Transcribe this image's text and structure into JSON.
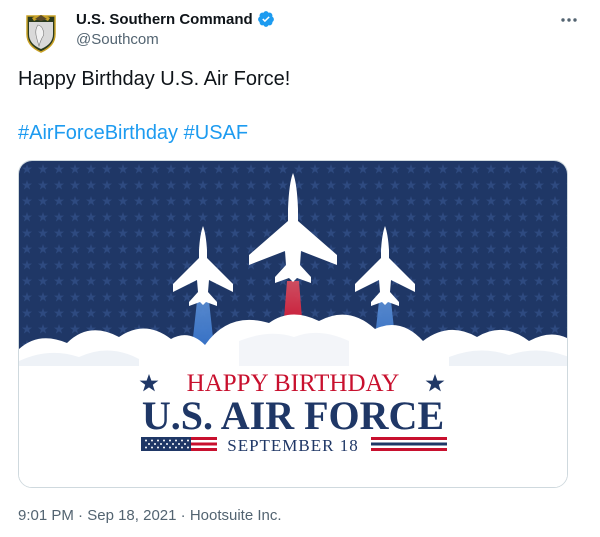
{
  "author": {
    "display_name": "U.S. Southern Command",
    "handle": "@Southcom",
    "verified": true,
    "avatar_icon": "southcom-seal-icon"
  },
  "tweet": {
    "text": "Happy Birthday U.S. Air Force!",
    "hashtags": [
      "#AirForceBirthday",
      "#USAF"
    ]
  },
  "media": {
    "banner_line1": "HAPPY BIRTHDAY",
    "banner_line2": "U.S. AIR FORCE",
    "banner_date": "SEPTEMBER 18",
    "colors": {
      "navy": "#1f3766",
      "red": "#c8102e",
      "blue": "#1d9bf0"
    }
  },
  "meta": {
    "time": "9:01 PM",
    "date": "Sep 18, 2021",
    "source": "Hootsuite Inc.",
    "separator": "·"
  }
}
